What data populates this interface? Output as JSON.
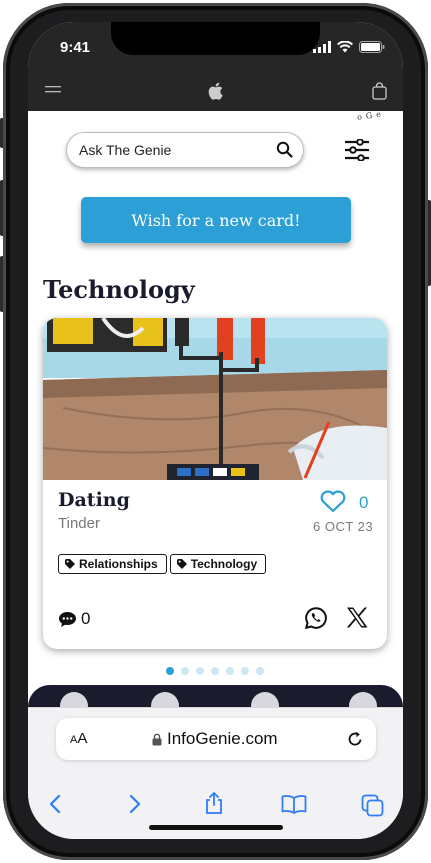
{
  "status_bar": {
    "time": "9:41"
  },
  "header": {
    "menu_icon": "hamburger-icon",
    "logo_icon": "apple-logo-icon",
    "bag_icon": "shopping-bag-icon"
  },
  "app": {
    "logo_text": "oGe",
    "search": {
      "placeholder": "Ask The Genie"
    },
    "wish_button": "Wish for a new card!",
    "section_title": "Technology"
  },
  "card": {
    "title": "Dating",
    "subtitle": "Tinder",
    "likes": "0",
    "date": "6 OCT 23",
    "tags": [
      "Relationships",
      "Technology"
    ],
    "comments": "0"
  },
  "pagination": {
    "total": 7,
    "active": 0
  },
  "browser": {
    "aa_small": "A",
    "aa_big": "A",
    "url": "InfoGenie.com"
  },
  "colors": {
    "accent": "#2b9fd6",
    "dark": "#1b1b2e",
    "bar": "#262626"
  }
}
